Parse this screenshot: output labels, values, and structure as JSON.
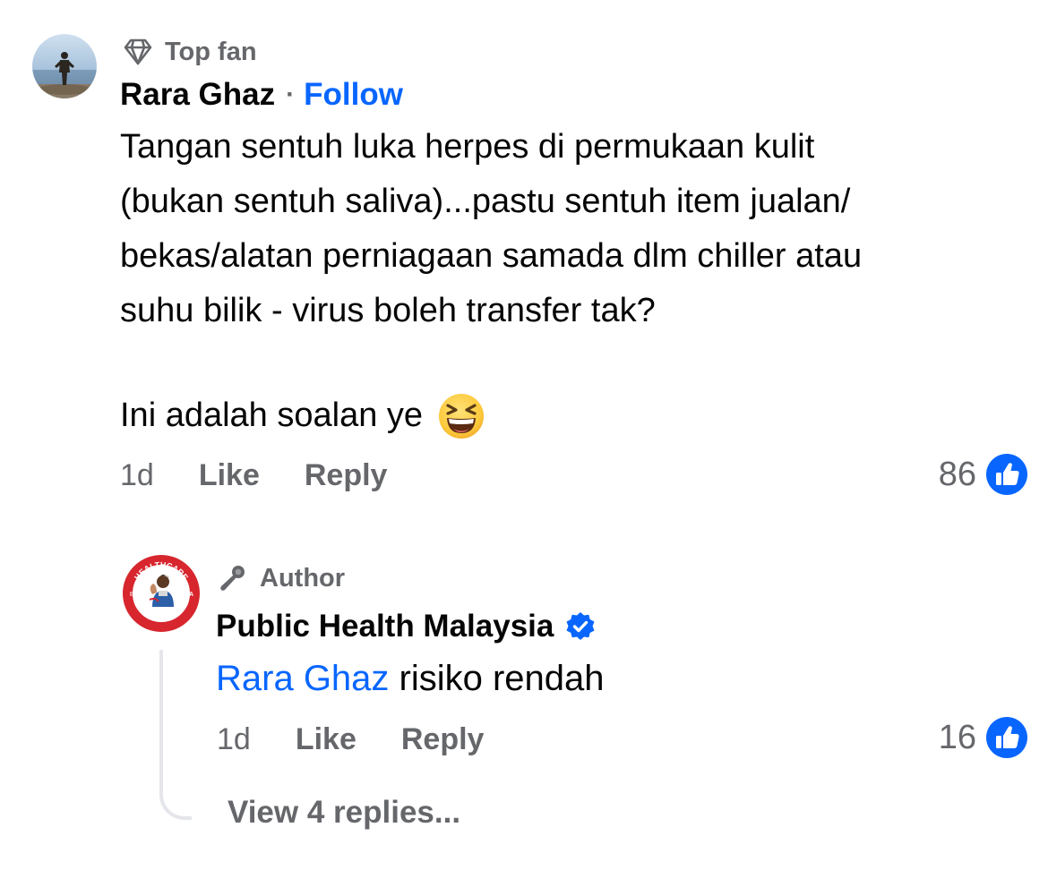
{
  "comment": {
    "badge": {
      "icon": "diamond-icon",
      "label": "Top fan"
    },
    "author": "Rara Ghaz",
    "separator": "·",
    "follow_label": "Follow",
    "text": "Tangan sentuh luka herpes di permukaan kulit\n(bukan sentuh saliva)...pastu sentuh item jualan/\nbekas/alatan perniagaan samada dlm chiller atau\nsuhu bilik - virus boleh transfer tak?",
    "text_2": "Ini adalah soalan ye",
    "emoji": "grinning-squinting-face-emoji",
    "time": "1d",
    "like_label": "Like",
    "reply_label": "Reply",
    "reaction_count": "86",
    "reaction_icon": "like-icon"
  },
  "reply": {
    "badge": {
      "icon": "microphone-icon",
      "label": "Author"
    },
    "author": "Public Health Malaysia",
    "verified_icon": "verified-badge-icon",
    "avatar_text_top": "HEALTHCARE",
    "avatar_text_bottom": "HUMAN RIGHT",
    "avatar_text_left": "IS",
    "avatar_text_right": "A",
    "mention": "Rara Ghaz",
    "text": " risiko rendah",
    "time": "1d",
    "like_label": "Like",
    "reply_label": "Reply",
    "reaction_count": "16",
    "reaction_icon": "like-icon",
    "view_replies_label": "View 4 replies..."
  },
  "colors": {
    "link_blue": "#0866ff",
    "secondary_text": "#65676b",
    "primary_text": "#050505",
    "thread_line": "#e4e6eb",
    "brand_red": "#d7262e"
  }
}
